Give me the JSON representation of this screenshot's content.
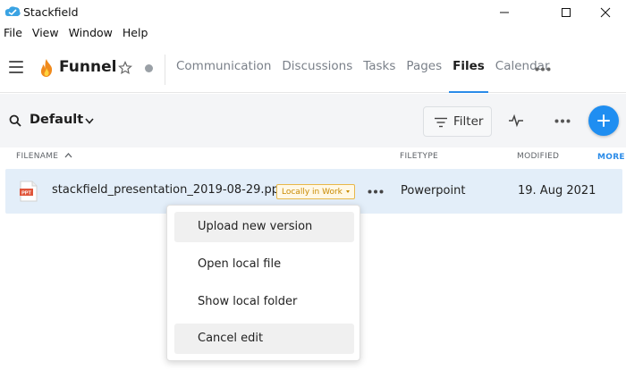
{
  "window": {
    "title": "Stackfield",
    "colors": {
      "logo": "#3aa3e3",
      "accent": "#1f8ef1"
    }
  },
  "menubar": {
    "items": [
      "File",
      "View",
      "Window",
      "Help"
    ]
  },
  "header": {
    "room_title": "Funnel",
    "tabs": [
      {
        "label": "Communication",
        "active": false
      },
      {
        "label": "Discussions",
        "active": false
      },
      {
        "label": "Tasks",
        "active": false
      },
      {
        "label": "Pages",
        "active": false
      },
      {
        "label": "Files",
        "active": true
      },
      {
        "label": "Calendar",
        "active": false
      }
    ]
  },
  "toolbar": {
    "filter_name": "Default",
    "filter_button": "Filter"
  },
  "table": {
    "columns": {
      "filename": "FILENAME",
      "filetype": "FILETYPE",
      "modified": "MODIFIED",
      "more": "MORE"
    },
    "rows": [
      {
        "icon_label": "PPT",
        "filename": "stackfield_presentation_2019-08-29.pptx",
        "badge": "Locally in Work",
        "filetype": "Powerpoint",
        "modified": "19. Aug 2021"
      }
    ]
  },
  "context_menu": {
    "items": [
      {
        "label": "Upload new version",
        "highlighted": true
      },
      {
        "label": "Open local file",
        "highlighted": false
      },
      {
        "label": "Show local folder",
        "highlighted": false
      },
      {
        "label": "Cancel edit",
        "highlighted": true
      }
    ]
  }
}
